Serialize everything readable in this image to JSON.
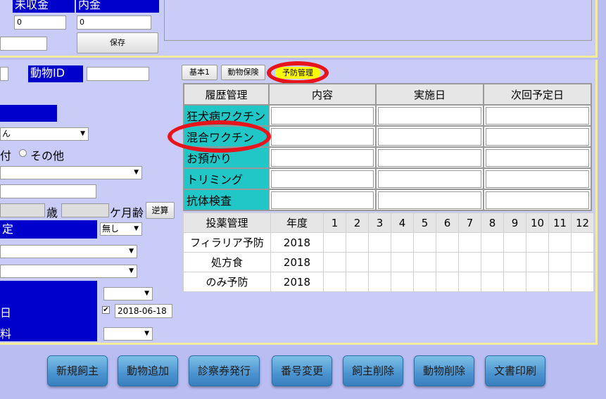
{
  "top": {
    "uncollected_label": "未収金",
    "uncollected_value": "0",
    "inner_label": "内金",
    "inner_value": "0",
    "save_button": "保存"
  },
  "form": {
    "animal_id_label": "動物ID",
    "animal_id_value": "",
    "pet_name_select": "ん",
    "radio_suffix": "付",
    "radio_other": "その他",
    "age_years_unit": "歳",
    "age_months_unit": "ケ月齢",
    "reverse_calc_button": "逆算",
    "blue_label_teiki": "定",
    "none_select": "無し",
    "date_label_fragment": "日",
    "fee_label_fragment": "料",
    "date_value": "2018-06-18",
    "date_checked": "✔"
  },
  "tabs": [
    {
      "label": "基本1"
    },
    {
      "label": "動物保険"
    },
    {
      "label": "予防管理"
    }
  ],
  "history": {
    "headers": [
      "履歴管理",
      "内容",
      "実施日",
      "次回予定日"
    ],
    "rows": [
      {
        "label": "狂犬病ワクチン"
      },
      {
        "label": "混合ワクチン"
      },
      {
        "label": "お預かり"
      },
      {
        "label": "トリミング"
      },
      {
        "label": "抗体検査"
      }
    ]
  },
  "medication": {
    "header_label": "投薬管理",
    "header_year": "年度",
    "months": [
      "1",
      "2",
      "3",
      "4",
      "5",
      "6",
      "7",
      "8",
      "9",
      "10",
      "11",
      "12"
    ],
    "rows": [
      {
        "name": "フィラリア予防",
        "year": "2018"
      },
      {
        "name": "処方食",
        "year": "2018"
      },
      {
        "name": "のみ予防",
        "year": "2018"
      }
    ]
  },
  "bottom_buttons": [
    {
      "label": "新規飼主"
    },
    {
      "label": "動物追加"
    },
    {
      "label": "診察券発行"
    },
    {
      "label": "番号変更"
    },
    {
      "label": "飼主削除"
    },
    {
      "label": "動物削除"
    },
    {
      "label": "文書印刷"
    }
  ],
  "colors": {
    "background": "#b9bdf2",
    "panel": "#c8ccf7",
    "blue_label": "#0000cc",
    "teal_row": "#21c7c7",
    "highlight_tab": "#ffff00",
    "annotation_red": "#e8141c",
    "panel_border": "#f2ec9b"
  }
}
